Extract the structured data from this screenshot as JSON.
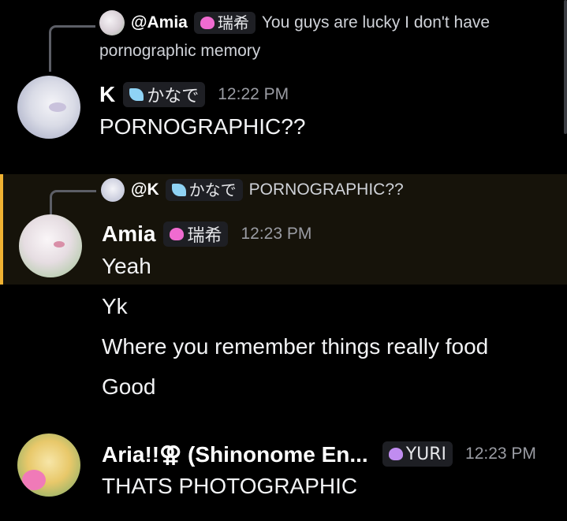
{
  "messages": [
    {
      "reply": {
        "mention": "@Amia",
        "tag_text": "瑞希",
        "tag_icon": "pink-flame-icon",
        "text_line1": "You guys are lucky I don't have",
        "text_line2": "pornographic memory"
      },
      "author": "K",
      "tag_text": "かなで",
      "tag_icon": "light-blue-feather-icon",
      "time": "12:22 PM",
      "lines": [
        "PORNOGRAPHIC??"
      ]
    },
    {
      "reply": {
        "mention": "@K",
        "tag_text": "かなで",
        "tag_icon": "light-blue-feather-icon",
        "text_line1": "PORNOGRAPHIC??"
      },
      "author": "Amia",
      "tag_text": "瑞希",
      "tag_icon": "pink-flame-icon",
      "time": "12:23 PM",
      "lines": [
        "Yeah",
        "Yk",
        "Where you remember things really food",
        "Good"
      ],
      "highlighted": true
    },
    {
      "author": "Aria!!⚢ (Shinonome En...",
      "tag_text": "YURI",
      "tag_icon": "purple-heart-icon",
      "time": "12:23 PM",
      "lines": [
        "THATS PHOTOGRAPHIC"
      ]
    }
  ],
  "colors": {
    "background": "#000000",
    "highlight_bg": "#16130a",
    "highlight_border": "#f0b232",
    "timestamp": "#9a9ca3",
    "tag_bg": "#1e1f24",
    "pink_tag": "#f06bd0",
    "blue_tag": "#8fd3f5",
    "purple_tag": "#c08cf0"
  }
}
